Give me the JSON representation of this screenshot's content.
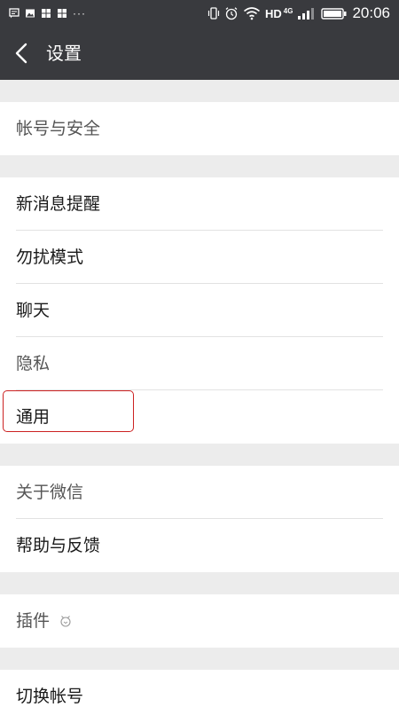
{
  "status_bar": {
    "left_icons": [
      "message-icon",
      "image-icon",
      "app-icon",
      "app-icon"
    ],
    "more": "···",
    "network": "HD",
    "network_sup": "4G",
    "time": "20:06"
  },
  "header": {
    "title": "设置"
  },
  "groups": [
    {
      "items": [
        {
          "label": "帐号与安全"
        }
      ]
    },
    {
      "items": [
        {
          "label": "新消息提醒"
        },
        {
          "label": "勿扰模式"
        },
        {
          "label": "聊天"
        },
        {
          "label": "隐私"
        },
        {
          "label": "通用"
        }
      ]
    },
    {
      "items": [
        {
          "label": "关于微信"
        },
        {
          "label": "帮助与反馈"
        }
      ]
    },
    {
      "items": [
        {
          "label": "插件"
        }
      ]
    },
    {
      "items": [
        {
          "label": "切换帐号"
        }
      ]
    }
  ],
  "colors": {
    "header_bg": "#393a3e",
    "page_bg": "#ececec",
    "highlight": "#cc2222"
  }
}
